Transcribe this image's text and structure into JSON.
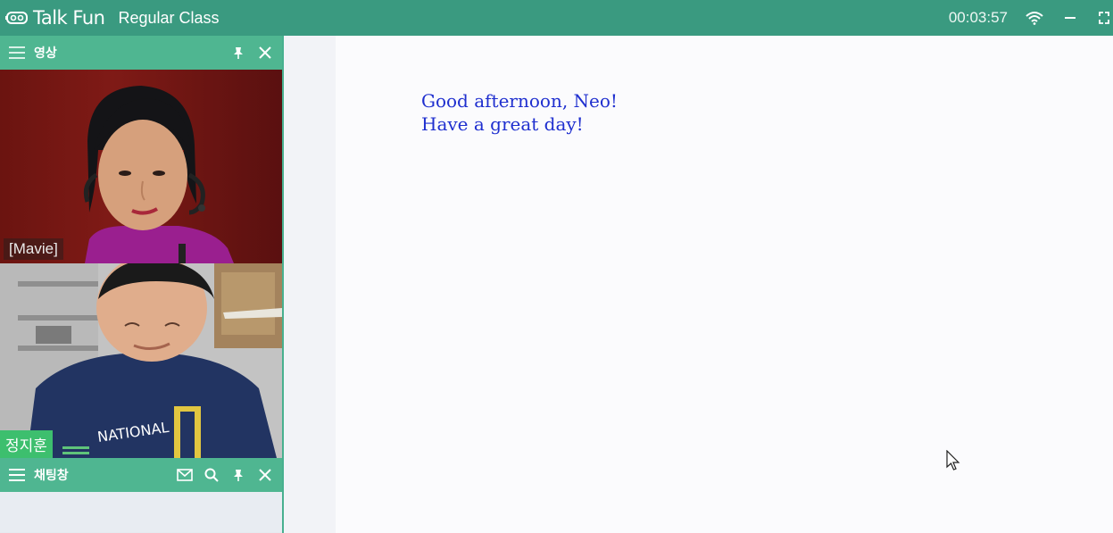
{
  "titlebar": {
    "brand": "Talk Fun",
    "class_title": "Regular Class",
    "timer": "00:03:57"
  },
  "video_panel": {
    "title": "영상",
    "videos": [
      {
        "label": "[Mavie]"
      },
      {
        "label": "정지훈"
      }
    ]
  },
  "chat_panel": {
    "title": "채팅창"
  },
  "content": {
    "greeting_line1": "Good afternoon, Neo!",
    "greeting_line2": "Have a great day!"
  },
  "colors": {
    "titlebar": "#3a9a80",
    "panel_header": "#4fb691",
    "greeting_text": "#1f2fcf",
    "name_badge": "#3dbf6e"
  },
  "icons": [
    "logo-icon",
    "wifi-icon",
    "minimize-icon",
    "fullscreen-icon",
    "menu-icon",
    "pin-icon",
    "close-icon",
    "mail-icon",
    "search-icon",
    "cursor-icon"
  ]
}
